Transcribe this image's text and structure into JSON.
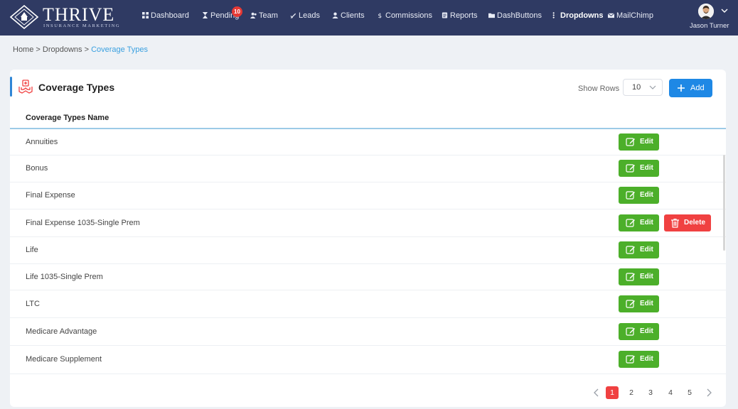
{
  "header": {
    "logo_word": "THRIVE",
    "logo_sub": "INSURANCE MARKETING",
    "nav": [
      {
        "label": "Dashboard",
        "icon": "dashboard-icon"
      },
      {
        "label": "Pending",
        "icon": "hourglass-icon",
        "badge": "10"
      },
      {
        "label": "Team",
        "icon": "team-icon"
      },
      {
        "label": "Leads",
        "icon": "leads-icon"
      },
      {
        "label": "Clients",
        "icon": "clients-icon"
      },
      {
        "label": "Commissions",
        "icon": "dollar-icon"
      },
      {
        "label": "Reports",
        "icon": "reports-icon"
      },
      {
        "label": "DashButtons",
        "icon": "folder-icon"
      },
      {
        "label": "Dropdowns",
        "icon": "dropdowns-icon",
        "active": true
      },
      {
        "label": "MailChimp",
        "icon": "mail-icon"
      }
    ],
    "user_name": "Jason Turner"
  },
  "breadcrumb": {
    "home": "Home",
    "sep1": " > ",
    "parent": "Dropdowns",
    "sep2": " > ",
    "current": "Coverage Types"
  },
  "card": {
    "title": "Coverage Types",
    "show_rows_label": "Show Rows",
    "rows_value": "10",
    "add_label": "Add",
    "column_header": "Coverage Types Name",
    "edit_label": "Edit",
    "delete_label": "Delete",
    "rows": [
      {
        "name": "Annuities",
        "deletable": false
      },
      {
        "name": "Bonus",
        "deletable": false
      },
      {
        "name": "Final Expense",
        "deletable": false
      },
      {
        "name": "Final Expense 1035-Single Prem",
        "deletable": true
      },
      {
        "name": "Life",
        "deletable": false
      },
      {
        "name": "Life 1035-Single Prem",
        "deletable": false
      },
      {
        "name": "LTC",
        "deletable": false
      },
      {
        "name": "Medicare Advantage",
        "deletable": false
      },
      {
        "name": "Medicare Supplement",
        "deletable": false
      }
    ]
  },
  "pagination": {
    "pages": [
      "1",
      "2",
      "3",
      "4",
      "5"
    ],
    "active": "1"
  },
  "colors": {
    "header_bg": "#2f3a63",
    "edit_green": "#4caf2a",
    "delete_red": "#f04141",
    "add_blue": "#1e88e5",
    "link_blue": "#3aa0e0"
  }
}
